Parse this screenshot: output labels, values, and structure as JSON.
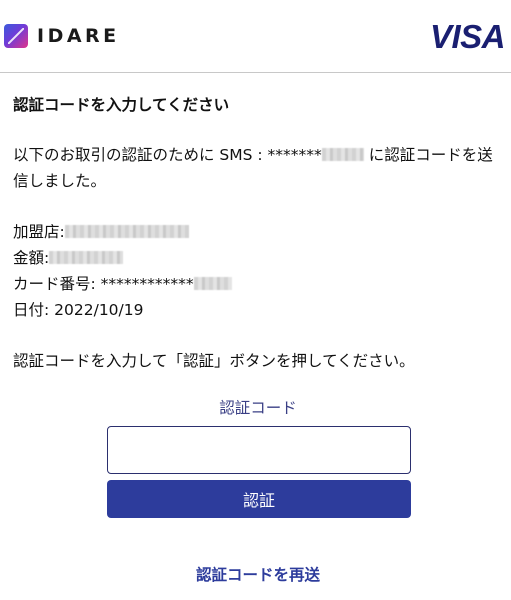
{
  "header": {
    "brand_name": "IDARE",
    "card_network": "VISA",
    "network_color": "#1a1f71"
  },
  "heading": "認証コードを入力してください",
  "intro": {
    "before": "以下のお取引の認証のために SMS : *******",
    "after": " に認証コードを送信しました。"
  },
  "details": {
    "merchant_label": "加盟店:",
    "amount_label": "金額:",
    "card_label": "カード番号: ************",
    "date_label": "日付: ",
    "date_value": "2022/10/19"
  },
  "instruction": "認証コードを入力して「認証」ボタンを押してください。",
  "form": {
    "code_label": "認証コード",
    "code_value": "",
    "submit_label": "認証",
    "submit_color": "#2d3c9c"
  },
  "resend_label": "認証コードを再送"
}
